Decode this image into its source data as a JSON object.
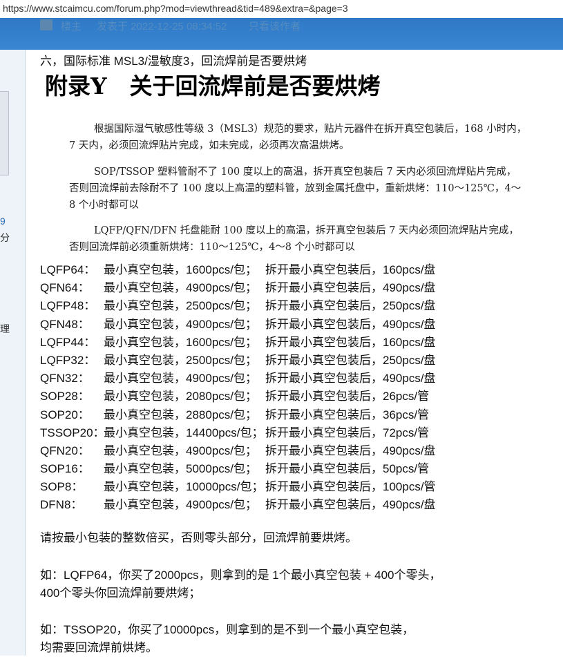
{
  "browser": {
    "url": "https://www.stcaimcu.com/forum.php?mod=viewthread&tid=489&extra=&page=3"
  },
  "post_header": {
    "author_tag": "楼主",
    "posted_at": "发表于 2022-12-25 08:34:52",
    "only_author": "只看该作者"
  },
  "sidebar": {
    "fragments": [
      "9",
      "分",
      "理"
    ]
  },
  "post": {
    "subject": "六，国际标准 MSL3/湿敏度3，回流焊前是否要烘烤",
    "appendix_title": "附录Y　关于回流焊前是否要烘烤",
    "paragraphs": [
      {
        "lines": [
          "根据国际湿气敏感性等级 3（MSL3）规范的要求，贴片元器件在拆开真空包装后，168 小时内，",
          "7 天内，必须回流焊贴片完成，如未完成，必须再次高温烘烤。"
        ]
      },
      {
        "lines": [
          "SOP/TSSOP 塑料管耐不了 100 度以上的高温，拆开真空包装后 7 天内必须回流焊贴片完成，",
          "否则回流焊前去除耐不了 100 度以上高温的塑料管，放到金属托盘中，重新烘烤：110～125℃，4～",
          "8 个小时都可以"
        ]
      },
      {
        "lines": [
          "LQFP/QFN/DFN 托盘能耐 100 度以上的高温，拆开真空包装后 7 天内必须回流焊贴片完成，",
          "否则回流焊前必须重新烘烤：110～125℃，4～8 个小时都可以"
        ]
      }
    ],
    "packages": [
      {
        "name": "LQFP64：",
        "min": "最小真空包装，1600pcs/包；",
        "after": "拆开最小真空包装后，160pcs/盘"
      },
      {
        "name": "QFN64：",
        "min": "最小真空包装，4900pcs/包；",
        "after": "拆开最小真空包装后，490pcs/盘"
      },
      {
        "name": "LQFP48：",
        "min": "最小真空包装，2500pcs/包；",
        "after": "拆开最小真空包装后，250pcs/盘"
      },
      {
        "name": "QFN48：",
        "min": "最小真空包装，4900pcs/包；",
        "after": "拆开最小真空包装后，490pcs/盘"
      },
      {
        "name": "LQFP44：",
        "min": "最小真空包装，1600pcs/包；",
        "after": "拆开最小真空包装后，160pcs/盘"
      },
      {
        "name": "LQFP32：",
        "min": "最小真空包装，2500pcs/包；",
        "after": "拆开最小真空包装后，250pcs/盘"
      },
      {
        "name": "QFN32：",
        "min": "最小真空包装，4900pcs/包；",
        "after": "拆开最小真空包装后，490pcs/盘"
      },
      {
        "name": "SOP28：",
        "min": "最小真空包装，2080pcs/包；",
        "after": "拆开最小真空包装后，26pcs/管"
      },
      {
        "name": "SOP20：",
        "min": "最小真空包装，2880pcs/包；",
        "after": "拆开最小真空包装后，36pcs/管"
      },
      {
        "name": "TSSOP20：",
        "min": "最小真空包装，14400pcs/包；",
        "after": "拆开最小真空包装后，72pcs/管"
      },
      {
        "name": "QFN20：",
        "min": "最小真空包装，4900pcs/包；",
        "after": "拆开最小真空包装后，490pcs/盘"
      },
      {
        "name": "SOP16：",
        "min": "最小真空包装，5000pcs/包；",
        "after": "拆开最小真空包装后，50pcs/管"
      },
      {
        "name": "SOP8：",
        "min": "最小真空包装，10000pcs/包；",
        "after": "拆开最小真空包装后，100pcs/管"
      },
      {
        "name": "DFN8：",
        "min": "最小真空包装，4900pcs/包；",
        "after": "拆开最小真空包装后，490pcs/盘"
      }
    ],
    "note_multiple": "请按最小包装的整数倍买，否则零头部分，回流焊前要烘烤。",
    "example1": [
      "如：LQFP64，你买了2000pcs，则拿到的是 1个最小真空包装 + 400个零头，",
      "400个零头你回流焊前要烘烤；"
    ],
    "example2": [
      "如：TSSOP20，你买了10000pcs，则拿到的是不到一个最小真空包装，",
      "均需要回流焊前烘烤。"
    ]
  },
  "colors": {
    "header_blue": "#3a86d2",
    "sidebar_bg": "#eef3fa",
    "link_blue": "#2a6bb8"
  }
}
